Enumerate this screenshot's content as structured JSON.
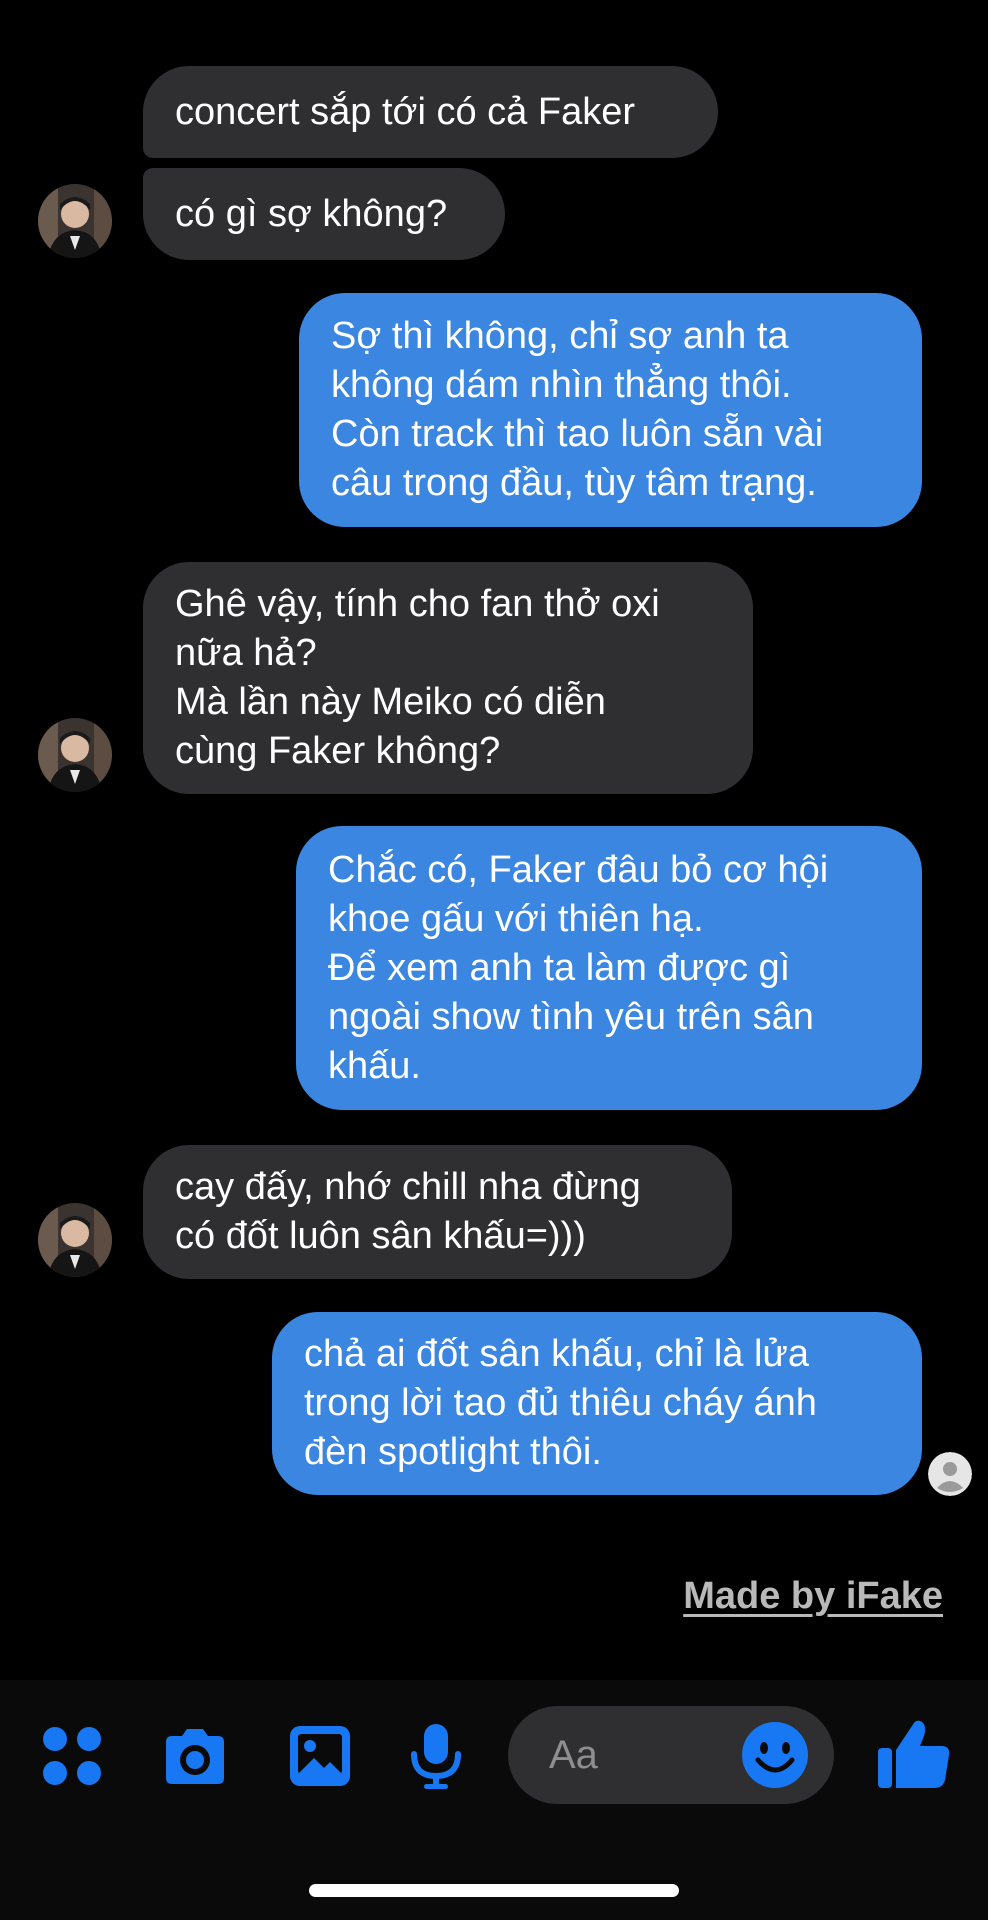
{
  "messages": [
    {
      "text": "concert sắp tới có cả Faker"
    },
    {
      "text": "có gì sợ không?"
    },
    {
      "text": "Sợ thì không, chỉ sợ anh ta\nkhông dám nhìn thẳng thôi.\nCòn track thì tao luôn sẵn vài\ncâu trong đầu, tùy tâm trạng."
    },
    {
      "text": "Ghê vậy, tính cho fan thở oxi\nnữa hả?\nMà lần này Meiko có diễn\ncùng Faker không?"
    },
    {
      "text": "Chắc có, Faker đâu bỏ cơ hội\nkhoe gấu với thiên hạ.\nĐể xem anh ta làm được gì\nngoài show tình yêu trên sân\nkhấu."
    },
    {
      "text": "cay đấy, nhớ chill nha đừng\ncó đốt luôn sân khấu=)))"
    },
    {
      "text": "chả ai đốt sân khấu, chỉ là lửa\ntrong lời tao đủ thiêu cháy ánh\nđèn spotlight thôi."
    }
  ],
  "watermark": "Made by iFake",
  "composer": {
    "placeholder": "Aa",
    "icons": [
      "apps-icon",
      "camera-icon",
      "gallery-icon",
      "microphone-icon",
      "emoji-icon",
      "thumbs-up-icon"
    ]
  },
  "colors": {
    "background": "#000000",
    "incoming_bubble": "#2f2f31",
    "outgoing_bubble": "#3a86e0",
    "accent": "#1877f2"
  }
}
